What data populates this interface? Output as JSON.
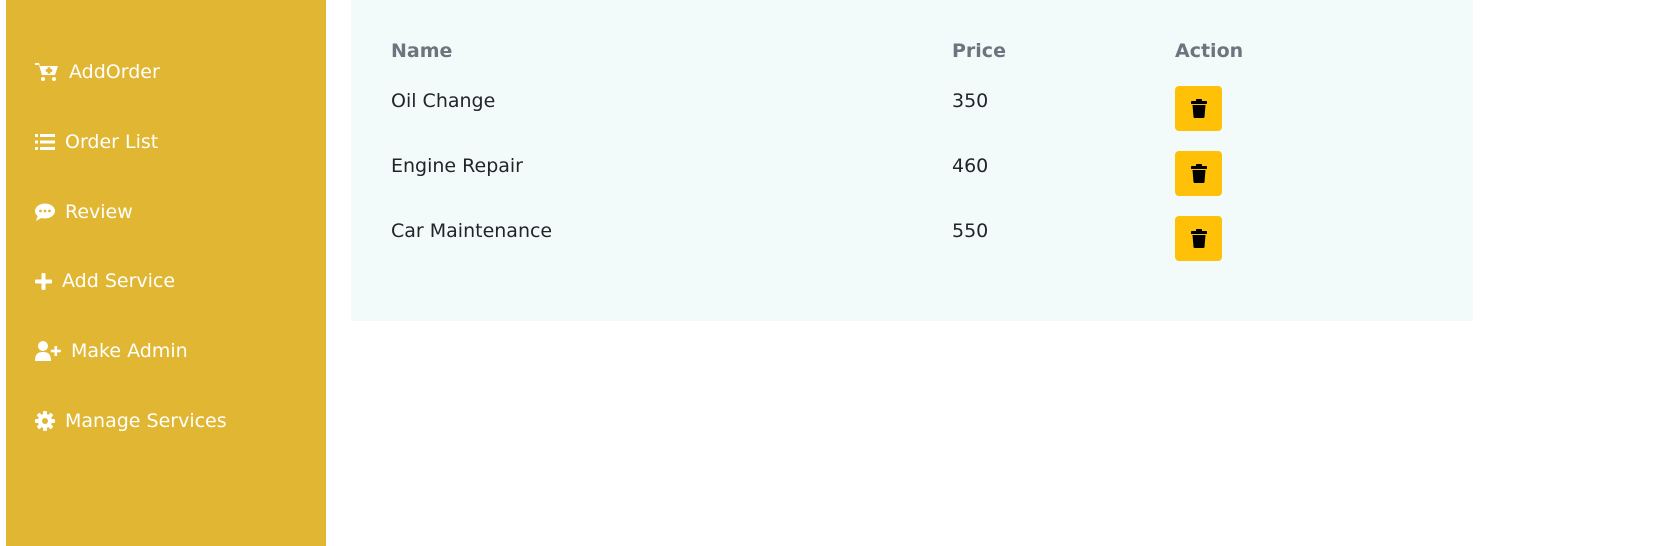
{
  "sidebar": {
    "background": "#e0b632",
    "items": [
      {
        "label": "AddOrder",
        "icon": "cart-plus-icon"
      },
      {
        "label": "Order List",
        "icon": "list-icon"
      },
      {
        "label": "Review",
        "icon": "comment-icon"
      },
      {
        "label": "Add Service",
        "icon": "plus-icon"
      },
      {
        "label": "Make Admin",
        "icon": "user-plus-icon"
      },
      {
        "label": "Manage Services",
        "icon": "gear-icon"
      }
    ]
  },
  "table": {
    "headers": {
      "name": "Name",
      "price": "Price",
      "action": "Action"
    },
    "rows": [
      {
        "name": "Oil Change",
        "price": "350",
        "action_icon": "trash-icon"
      },
      {
        "name": "Engine Repair",
        "price": "460",
        "action_icon": "trash-icon"
      },
      {
        "name": "Car Maintenance",
        "price": "550",
        "action_icon": "trash-icon"
      }
    ],
    "button_color": "#ffc107"
  }
}
